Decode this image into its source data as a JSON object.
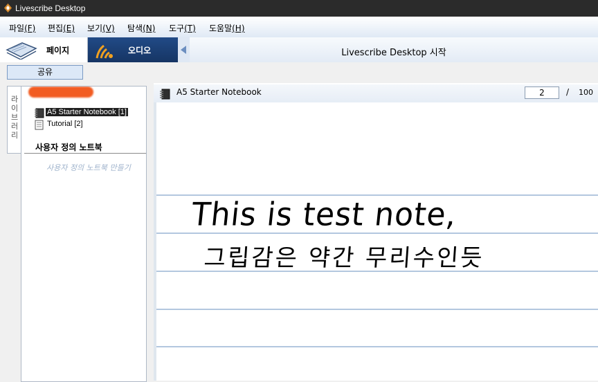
{
  "window": {
    "title": "Livescribe Desktop"
  },
  "menu": [
    {
      "label": "파일",
      "key": "(F)"
    },
    {
      "label": "편집",
      "key": "(E)"
    },
    {
      "label": "보기",
      "key": "(V)"
    },
    {
      "label": "탐색",
      "key": "(N)"
    },
    {
      "label": "도구",
      "key": "(T)"
    },
    {
      "label": "도움말",
      "key": "(H)"
    }
  ],
  "tabs": {
    "pages": "페이지",
    "audio": "오디오"
  },
  "header": {
    "title": "Livescribe Desktop 시작"
  },
  "toolbar": {
    "share": "공유"
  },
  "library": {
    "tab_label": [
      "라",
      "이",
      "브",
      "러",
      "리"
    ],
    "notebooks": [
      {
        "label": "A5 Starter Notebook [1]",
        "selected": true,
        "icon": "notebook-icon"
      },
      {
        "label": "Tutorial [2]",
        "selected": false,
        "icon": "document-icon"
      }
    ],
    "custom_title": "사용자 정의 노트북",
    "custom_make": "사용자 정의 노트북 만들기"
  },
  "viewer": {
    "notebook_name": "A5 Starter Notebook",
    "page_current": "2",
    "page_separator": "/",
    "page_total": "100",
    "handwriting": [
      "This is test note,",
      "그립감은 약간 무리수인듯"
    ]
  },
  "colors": {
    "titlebar": "#2b2b2b",
    "audio_tab": "#1b3d73",
    "selection": "#1f1f1f",
    "ruled_line": "#b3c7df",
    "redaction": "#f25c22"
  }
}
